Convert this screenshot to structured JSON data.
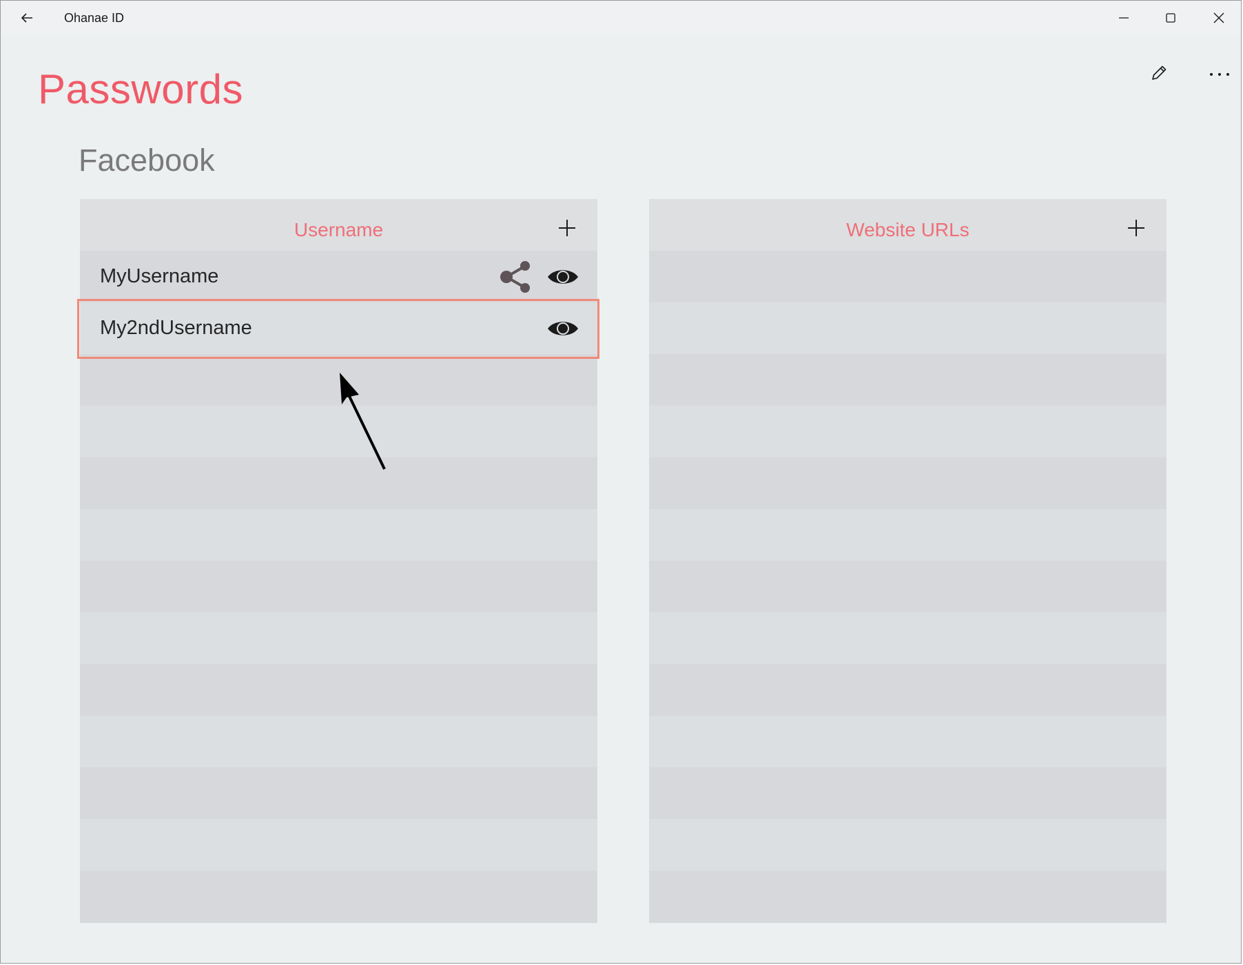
{
  "titlebar": {
    "app_title": "Ohanae ID"
  },
  "page": {
    "title": "Passwords",
    "section_title": "Facebook"
  },
  "username_panel": {
    "header": "Username",
    "rows": [
      {
        "label": "MyUsername"
      },
      {
        "label": "My2ndUsername"
      }
    ]
  },
  "website_panel": {
    "header": "Website URLs",
    "rows": []
  },
  "icons": {
    "back": "back-arrow-icon",
    "minimize": "minimize-icon",
    "maximize": "maximize-icon",
    "close": "close-icon",
    "edit": "pencil-icon",
    "more": "more-icon",
    "add": "plus-icon",
    "share": "share-icon",
    "reveal": "eye-icon"
  },
  "colors": {
    "accent": "#ef5a68",
    "header_text": "#ef6f78",
    "highlight": "#ef8a78",
    "background": "#edf0f1"
  }
}
